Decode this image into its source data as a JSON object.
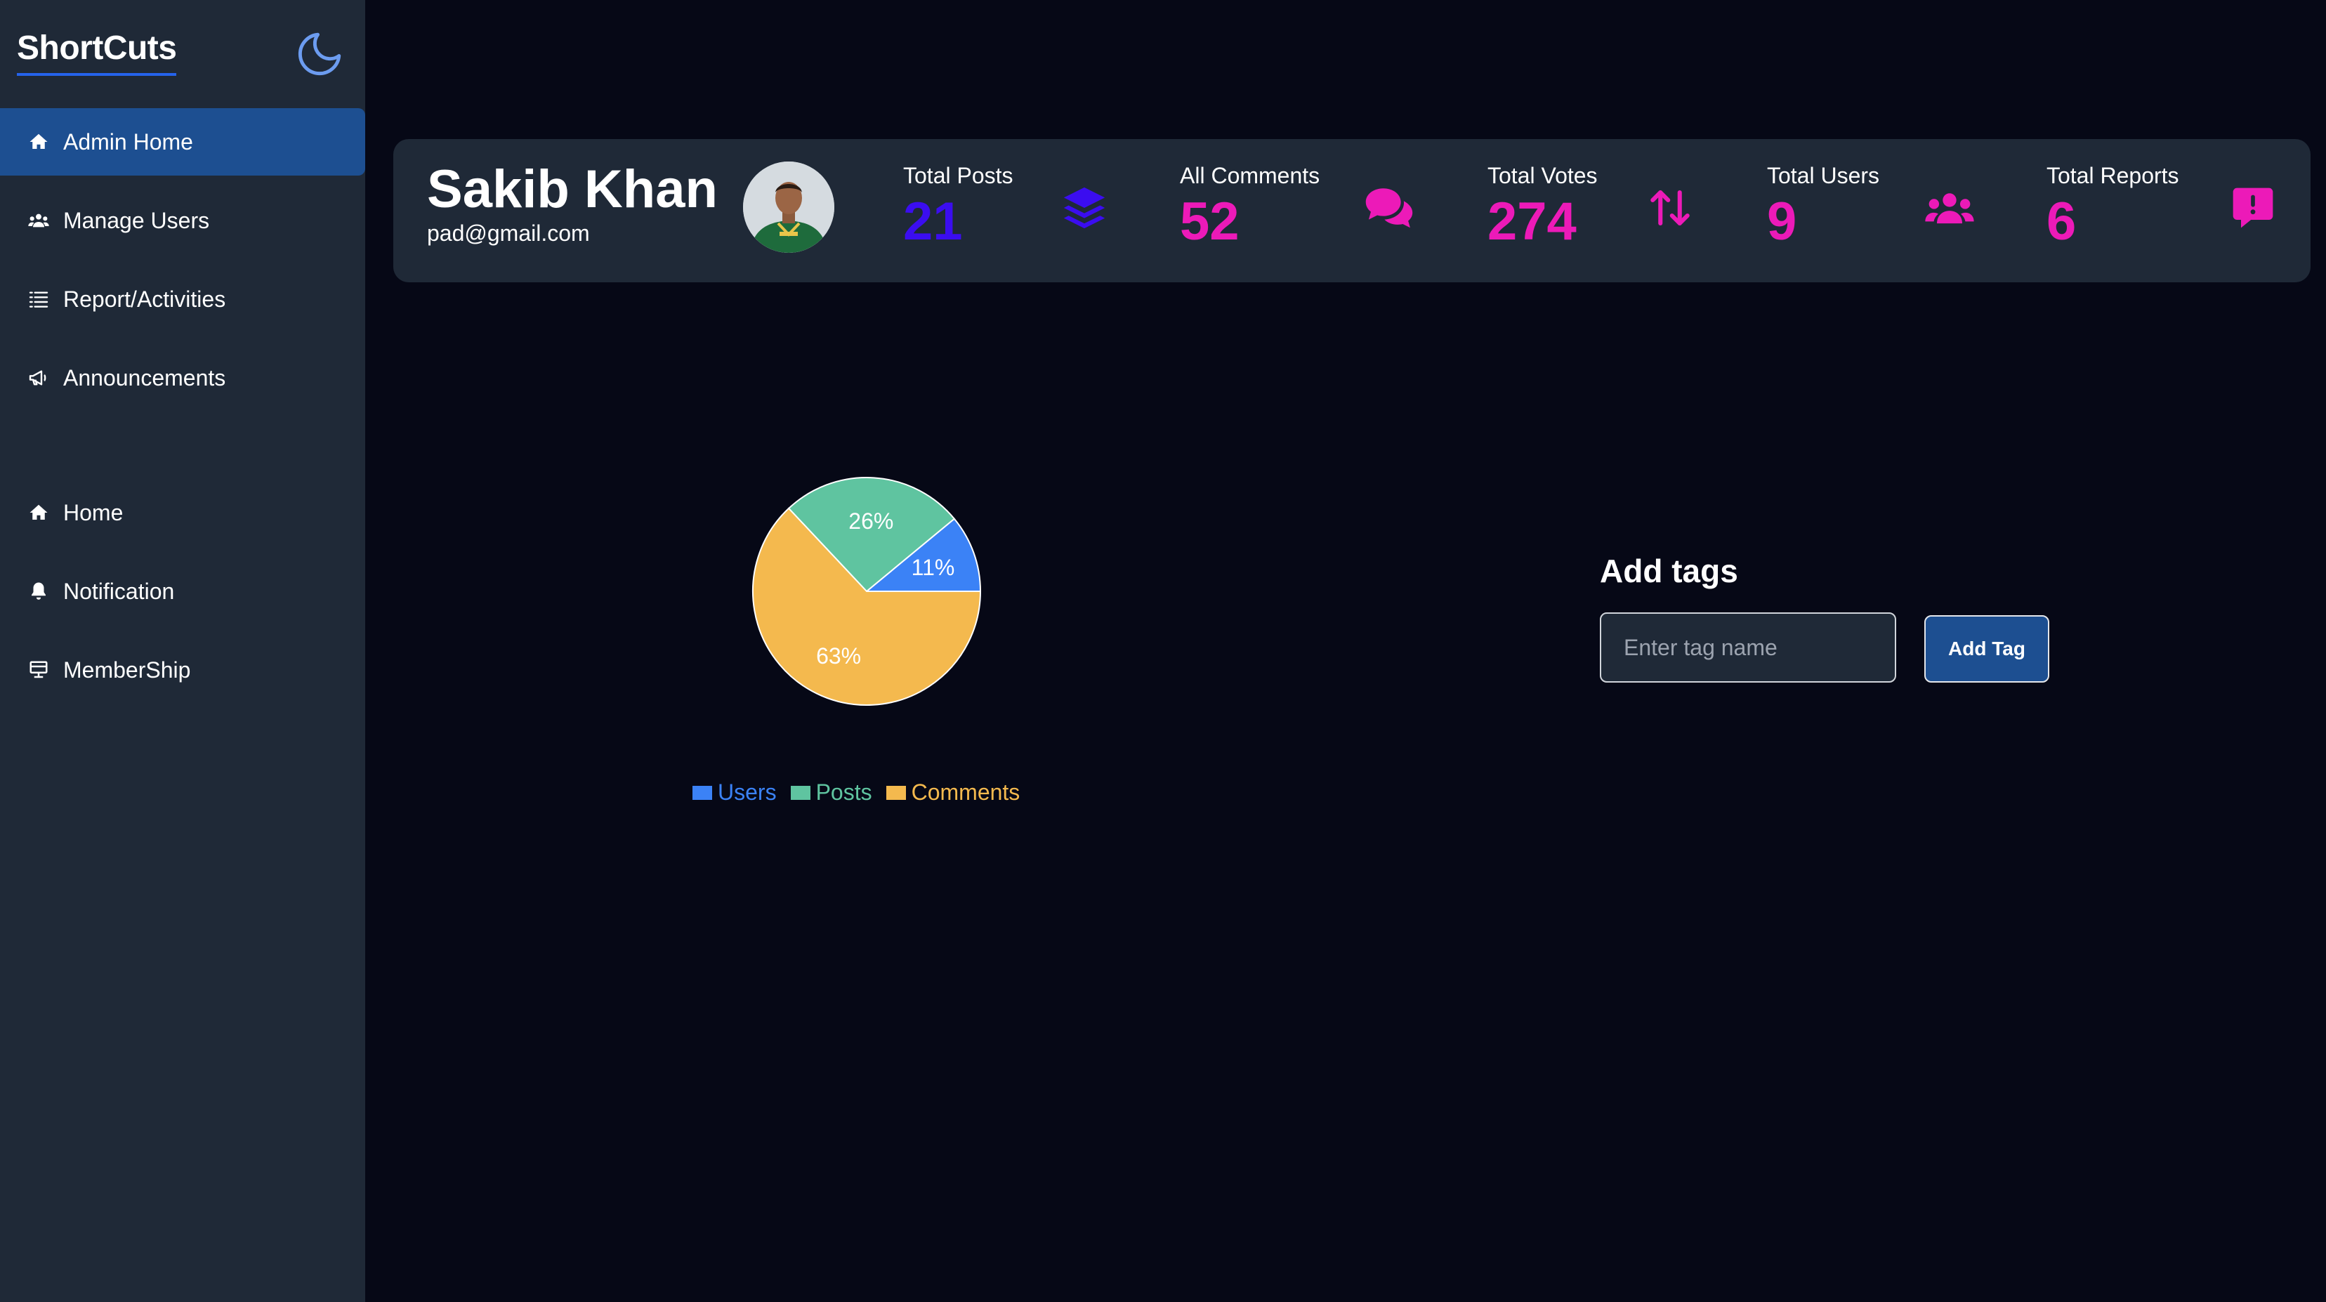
{
  "app": {
    "logo": "ShortCuts",
    "theme_toggle_icon": "moon-icon"
  },
  "sidebar": {
    "top_items": [
      {
        "label": "Admin Home",
        "icon": "home-icon",
        "active": true
      },
      {
        "label": "Manage Users",
        "icon": "users-icon",
        "active": false
      },
      {
        "label": "Report/Activities",
        "icon": "list-icon",
        "active": false
      },
      {
        "label": "Announcements",
        "icon": "megaphone-icon",
        "active": false
      }
    ],
    "bottom_items": [
      {
        "label": "Home",
        "icon": "home-icon",
        "active": false
      },
      {
        "label": "Notification",
        "icon": "bell-icon",
        "active": false
      },
      {
        "label": "MemberShip",
        "icon": "card-icon",
        "active": false
      }
    ]
  },
  "profile": {
    "name": "Sakib Khan",
    "email": "pad@gmail.com"
  },
  "stats": [
    {
      "label": "Total Posts",
      "value": "21",
      "icon": "layers-icon",
      "color": "#3b0df0"
    },
    {
      "label": "All Comments",
      "value": "52",
      "icon": "comments-icon",
      "color": "#ec1ab8"
    },
    {
      "label": "Total Votes",
      "value": "274",
      "icon": "arrows-up-down-icon",
      "color": "#ec1ab8"
    },
    {
      "label": "Total Users",
      "value": "9",
      "icon": "users-group-icon",
      "color": "#ec1ab8"
    },
    {
      "label": "Total Reports",
      "value": "6",
      "icon": "alert-message-icon",
      "color": "#ec1ab8"
    }
  ],
  "chart_data": {
    "type": "pie",
    "categories": [
      "Users",
      "Posts",
      "Comments"
    ],
    "values": [
      11,
      26,
      63
    ],
    "labels": [
      "11%",
      "26%",
      "63%"
    ],
    "colors": [
      "#3b82f6",
      "#5fc4a0",
      "#f4b94e"
    ],
    "legend_position": "bottom"
  },
  "tags": {
    "title": "Add tags",
    "input_placeholder": "Enter tag name",
    "input_value": "",
    "button_label": "Add Tag"
  },
  "colors": {
    "background": "#060816",
    "panel": "#1f2937",
    "accent": "#1d4f91"
  }
}
